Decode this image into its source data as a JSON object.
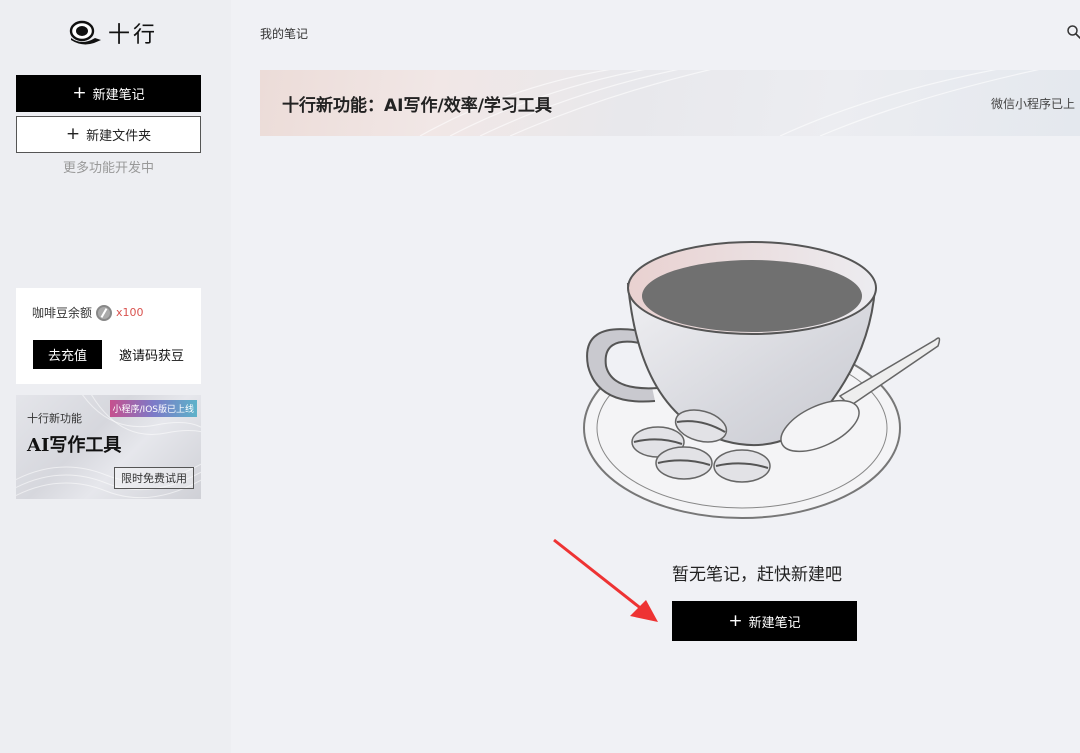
{
  "app": {
    "logo_text": "十行"
  },
  "sidebar": {
    "new_note_label": "新建笔记",
    "new_folder_label": "新建文件夹",
    "more_features_text": "更多功能开发中",
    "balance": {
      "label": "咖啡豆余额",
      "count": "x100",
      "recharge_label": "去充值",
      "invite_label": "邀请码获豆"
    },
    "promo": {
      "subtitle": "十行新功能",
      "title": "AI写作工具",
      "badge": "小程序/IOS版已上线",
      "trial_label": "限时免费试用"
    }
  },
  "header": {
    "breadcrumb": "我的笔记",
    "search_icon": "search-icon"
  },
  "banner": {
    "title": "十行新功能：AI写作/效率/学习工具",
    "right_text": "微信小程序已上"
  },
  "empty_state": {
    "message": "暂无笔记，赶快新建吧",
    "cta_label": "新建笔记"
  },
  "colors": {
    "primary": "#000000",
    "background": "#f0f1f5",
    "sidebar_bg": "#edeef2",
    "accent_red": "#d9534f"
  }
}
